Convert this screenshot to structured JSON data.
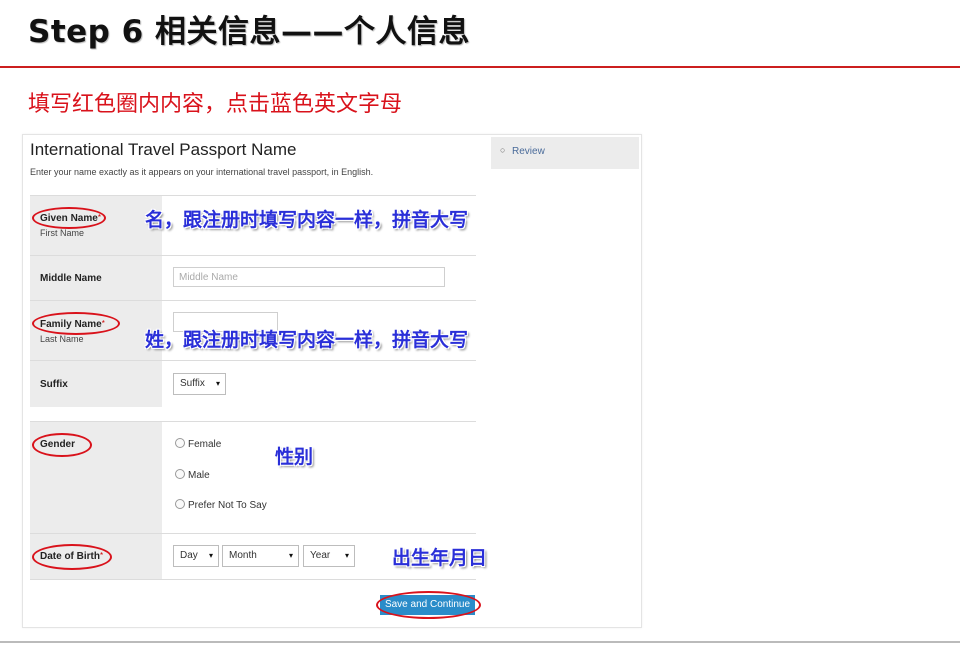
{
  "slide": {
    "title": "Step 6 相关信息——个人信息",
    "instruction": "填写红色圈内内容，点击蓝色英文字母"
  },
  "sidebar": {
    "review_label": "Review",
    "review_bullet": "○"
  },
  "form": {
    "title": "International Travel Passport Name",
    "subtitle": "Enter your name exactly as it appears on your international travel passport, in English.",
    "given_name": {
      "label": "Given Name",
      "required_mark": "*",
      "sublabel": "First Name",
      "value": ""
    },
    "middle_name": {
      "label": "Middle Name",
      "placeholder": "Middle Name"
    },
    "family_name": {
      "label": "Family Name",
      "required_mark": "*",
      "sublabel": "Last Name",
      "value": ""
    },
    "suffix": {
      "label": "Suffix",
      "selected": "Suffix",
      "arrow": "▾"
    },
    "gender": {
      "label": "Gender",
      "options": [
        "Female",
        "Male",
        "Prefer Not To Say"
      ]
    },
    "dob": {
      "label": "Date of Birth",
      "required_mark": "*",
      "day": "Day",
      "month": "Month",
      "year": "Year",
      "arrow": "▾"
    },
    "save_label": "Save and Continue"
  },
  "annotations": {
    "given_name_note": "名，跟注册时填写内容一样，拼音大写",
    "family_name_note": "姓，跟注册时填写内容一样，拼音大写",
    "gender_note": "性别",
    "dob_note": "出生年月日"
  },
  "colors": {
    "accent_red": "#d9121b",
    "button_blue": "#2a8cc9",
    "annotation_blue": "#2a2fd8"
  }
}
